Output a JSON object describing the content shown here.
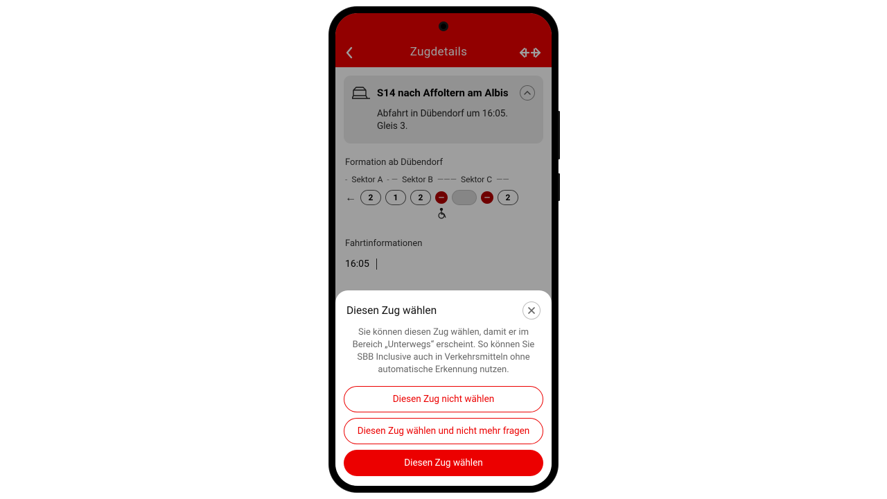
{
  "header": {
    "title": "Zugdetails"
  },
  "card": {
    "title": "S14 nach Affoltern am Albis",
    "sub_line1": "Abfahrt in Dübendorf um 16:05.",
    "sub_line2": "Gleis 3."
  },
  "formation": {
    "label": "Formation ab Dübendorf",
    "sectors": {
      "a": "Sektor A",
      "b": "Sektor B",
      "c": "Sektor C"
    },
    "cars": [
      "2",
      "1",
      "2",
      "2"
    ]
  },
  "info": {
    "label": "Fahrtinformationen",
    "time": "16:05"
  },
  "sheet": {
    "title": "Diesen Zug wählen",
    "text": "Sie können diesen Zug wählen, damit er im Bereich „Unterwegs“ erscheint. So können Sie SBB Inclusive auch in Verkehrsmitteln ohne automatische Erkennung nutzen.",
    "btn_dont": "Diesen Zug nicht wählen",
    "btn_choose_never": "Diesen Zug wählen und nicht mehr fragen",
    "btn_choose": "Diesen Zug wählen"
  }
}
